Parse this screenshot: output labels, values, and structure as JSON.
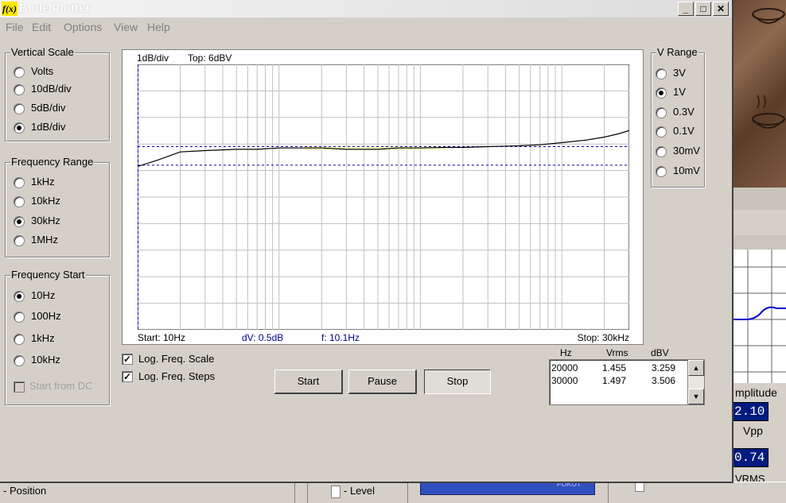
{
  "window": {
    "title": "Bode Plotter",
    "app_icon": "f(x)",
    "controls": {
      "minimize": "_",
      "maximize": "□",
      "close": "✕"
    }
  },
  "menu": [
    "File",
    "Edit",
    "Options",
    "View",
    "Help"
  ],
  "vertical_scale": {
    "title": "Vertical Scale",
    "options": [
      "Volts",
      "10dB/div",
      "5dB/div",
      "1dB/div"
    ],
    "selected": "1dB/div"
  },
  "frequency_range": {
    "title": "Frequency Range",
    "options": [
      "1kHz",
      "10kHz",
      "30kHz",
      "1MHz"
    ],
    "selected": "30kHz"
  },
  "frequency_start": {
    "title": "Frequency Start",
    "options": [
      "10Hz",
      "100Hz",
      "1kHz",
      "10kHz"
    ],
    "selected": "10Hz",
    "start_from_dc": "Start from DC"
  },
  "v_range": {
    "title": "V Range",
    "options": [
      "3V",
      "1V",
      "0.3V",
      "0.1V",
      "30mV",
      "10mV"
    ],
    "selected": "1V"
  },
  "plot": {
    "header_scale": "1dB/div",
    "header_top": "Top:  6dBV",
    "start_label": "Start: 10Hz",
    "dv_label": "dV: 0.5dB",
    "f_label": "f: 10.1Hz",
    "stop_label": "Stop: 30kHz",
    "colors": {
      "trace": "#000000",
      "cursor": "#0000aa",
      "grid": "#c0c0c0",
      "highlight": "#ffffc0"
    }
  },
  "chart_data": {
    "type": "line",
    "title": "",
    "xlabel": "",
    "ylabel": "",
    "x_scale": "log",
    "xlim": [
      10,
      30000
    ],
    "ylim": [
      -4,
      6
    ],
    "y_unit": "dBV",
    "grid": true,
    "series": [
      {
        "x": [
          10,
          14,
          20,
          30,
          50,
          70,
          100,
          150,
          200,
          300,
          500,
          700,
          1000,
          1500,
          2000,
          3000,
          5000,
          7000,
          10000,
          15000,
          20000,
          25000,
          30000
        ],
        "values": [
          2.15,
          2.4,
          2.7,
          2.75,
          2.8,
          2.8,
          2.85,
          2.85,
          2.85,
          2.8,
          2.8,
          2.85,
          2.85,
          2.87,
          2.87,
          2.9,
          2.93,
          2.97,
          3.05,
          3.15,
          3.26,
          3.38,
          3.51
        ]
      }
    ],
    "cursors": {
      "y_upper": 2.9,
      "y_lower": 2.2
    }
  },
  "checkboxes": {
    "log_freq_scale": {
      "label": "Log. Freq. Scale",
      "checked": true
    },
    "log_freq_steps": {
      "label": "Log. Freq. Steps",
      "checked": true
    }
  },
  "buttons": {
    "start": "Start",
    "pause": "Pause",
    "stop": "Stop"
  },
  "table": {
    "headers": [
      "Hz",
      "Vrms",
      "dBV"
    ],
    "rows": [
      [
        "20000",
        "1.455",
        "3.259"
      ],
      [
        "30000",
        "1.497",
        "3.506"
      ]
    ]
  },
  "background": {
    "amplitude_label": "mplitude",
    "amplitude_value": "2.10",
    "vpp_label": "Vpp",
    "vrms_value": "0.74",
    "vrms_label": "VRMS",
    "status_position": "Position",
    "status_level": "Level",
    "status_knob": "FOKUT"
  }
}
